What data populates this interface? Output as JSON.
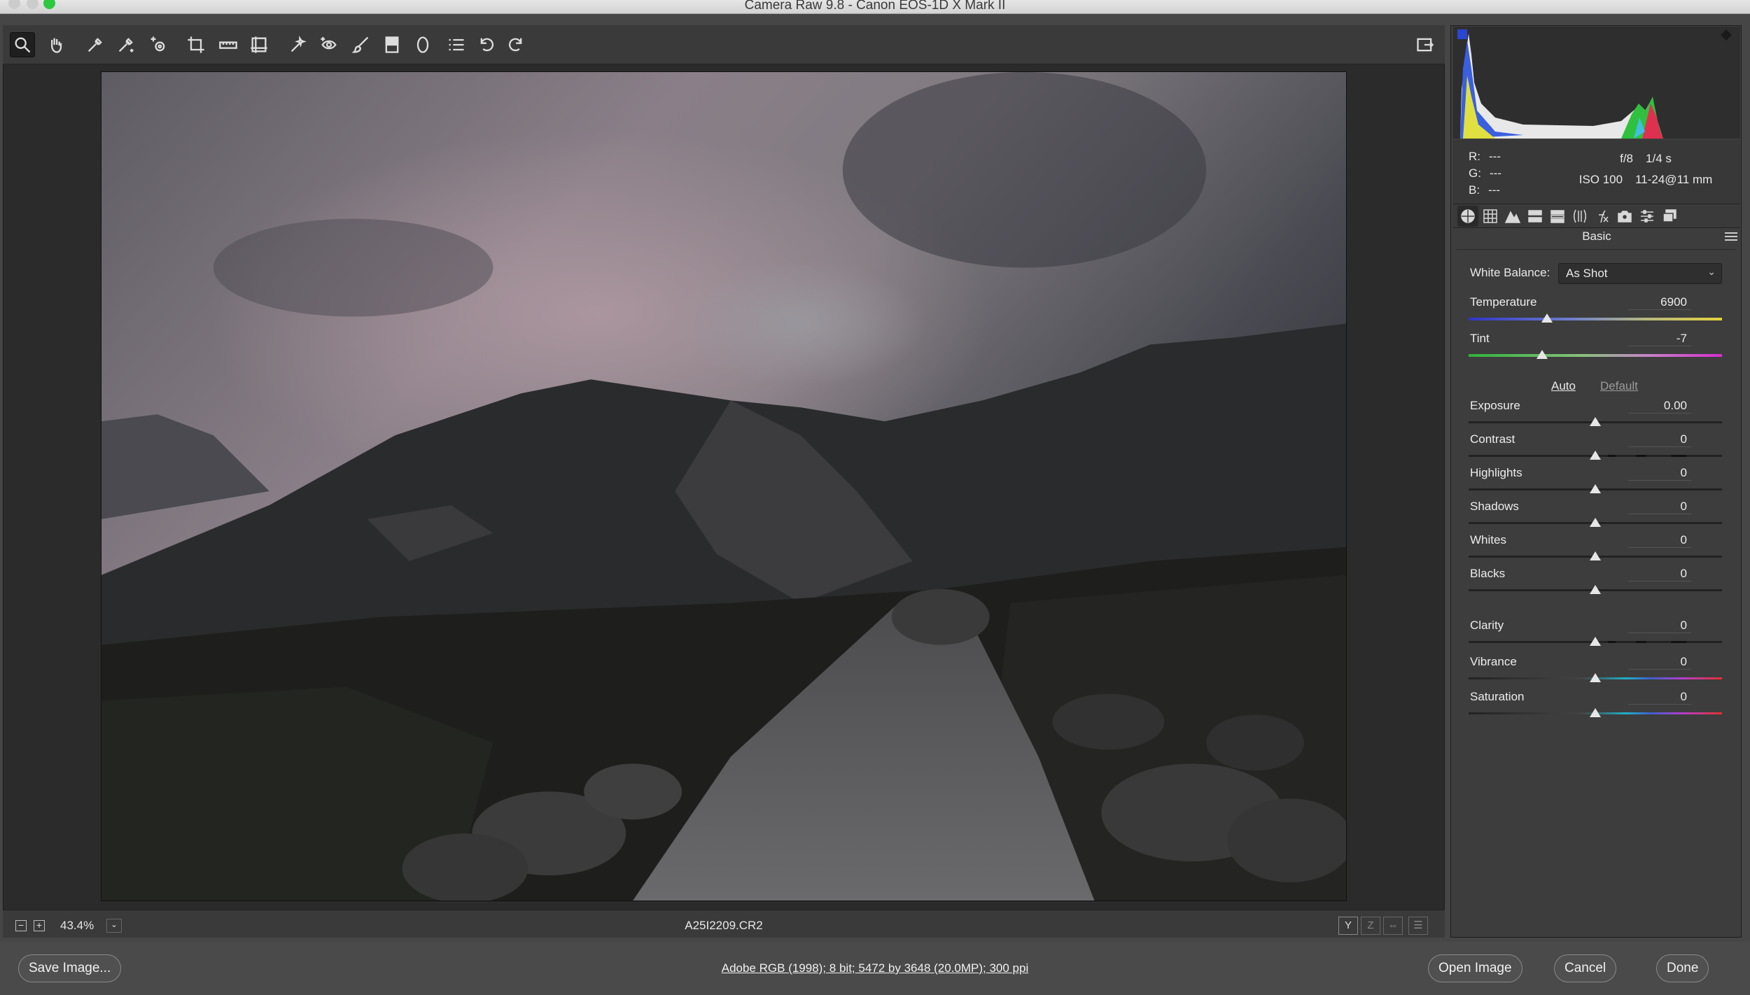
{
  "window": {
    "title": "Camera Raw 9.8  -  Canon EOS-1D X Mark II"
  },
  "toolbar": {
    "tools": [
      "zoom-tool",
      "hand-tool",
      "white-balance-tool",
      "color-sampler-tool",
      "targeted-adjustment-tool",
      "crop-tool",
      "straighten-tool",
      "transform-tool",
      "spot-removal-tool",
      "red-eye-removal-tool",
      "adjustment-brush-tool",
      "graduated-filter-tool",
      "radial-filter-tool",
      "preferences-tool",
      "rotate-ccw-tool",
      "rotate-cw-tool"
    ]
  },
  "status": {
    "zoom_out": "−",
    "zoom_in": "+",
    "zoom_level": "43.4%",
    "zoom_dropdown": "⌄",
    "filename": "A25I2209.CR2",
    "view_buttons": [
      "Y",
      "Z",
      "⇔",
      "☰"
    ]
  },
  "readouts": {
    "r_label": "R:",
    "r_value": "---",
    "g_label": "G:",
    "g_value": "---",
    "b_label": "B:",
    "b_value": "---",
    "aperture": "f/8",
    "shutter": "1/4 s",
    "iso": "ISO 100",
    "lens": "11-24@11 mm"
  },
  "panel": {
    "title": "Basic",
    "white_balance_label": "White Balance:",
    "white_balance_value": "As Shot",
    "auto_label": "Auto",
    "default_label": "Default",
    "sliders": [
      {
        "label": "Temperature",
        "value": "6900",
        "position": 0.31
      },
      {
        "label": "Tint",
        "value": "-7",
        "position": 0.29
      },
      {
        "label": "Exposure",
        "value": "0.00",
        "position": 0.5
      },
      {
        "label": "Contrast",
        "value": "0",
        "position": 0.5
      },
      {
        "label": "Highlights",
        "value": "0",
        "position": 0.5
      },
      {
        "label": "Shadows",
        "value": "0",
        "position": 0.5
      },
      {
        "label": "Whites",
        "value": "0",
        "position": 0.5
      },
      {
        "label": "Blacks",
        "value": "0",
        "position": 0.5
      },
      {
        "label": "Clarity",
        "value": "0",
        "position": 0.5
      },
      {
        "label": "Vibrance",
        "value": "0",
        "position": 0.5
      },
      {
        "label": "Saturation",
        "value": "0",
        "position": 0.5
      }
    ]
  },
  "bottom": {
    "save_label": "Save Image...",
    "workflow_text": "Adobe RGB (1998); 8 bit; 5472 by 3648 (20.0MP); 300 ppi",
    "open_label": "Open Image",
    "cancel_label": "Cancel",
    "done_label": "Done"
  },
  "colors": {
    "accent": "#2bc840",
    "panel_bg": "#3d3d3d",
    "canvas_bg": "#2b2b2b"
  }
}
